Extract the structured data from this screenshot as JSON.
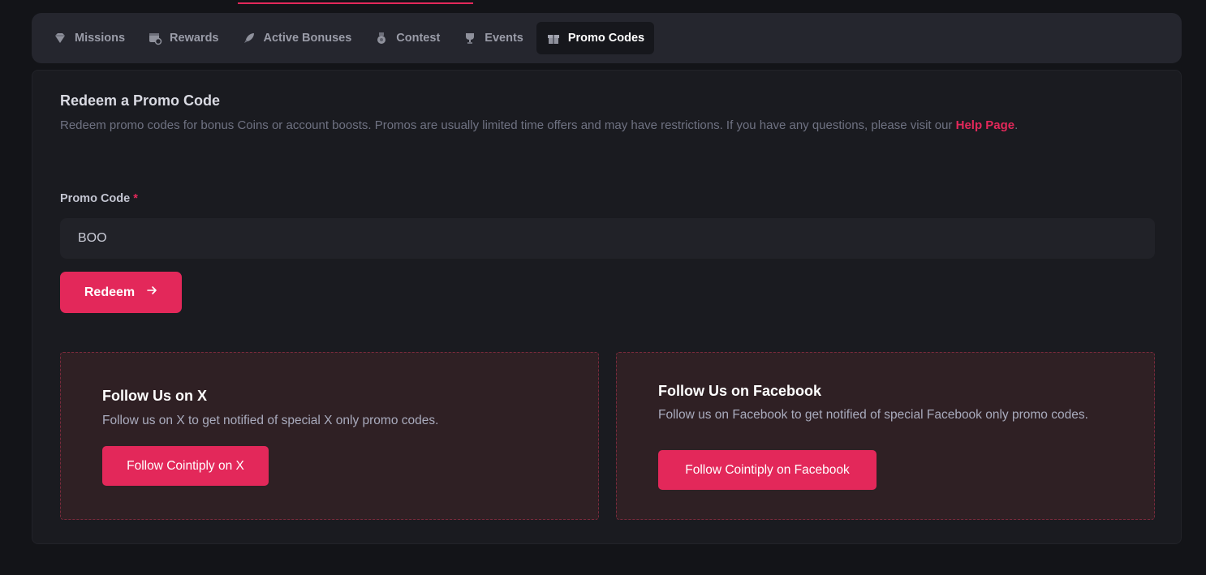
{
  "tabs": [
    {
      "label": "Missions",
      "icon": "diamond-icon"
    },
    {
      "label": "Rewards",
      "icon": "calendar-gear-icon"
    },
    {
      "label": "Active Bonuses",
      "icon": "rocket-icon"
    },
    {
      "label": "Contest",
      "icon": "medal-icon"
    },
    {
      "label": "Events",
      "icon": "trophy-icon"
    },
    {
      "label": "Promo Codes",
      "icon": "gift-box-icon",
      "active": true
    }
  ],
  "redeem": {
    "title": "Redeem a Promo Code",
    "description": "Redeem promo codes for bonus Coins or account boosts. Promos are usually limited time offers and may have restrictions. If you have any questions, please visit our ",
    "help_link": "Help Page",
    "description_end": ".",
    "field_label": "Promo Code",
    "required_marker": "*",
    "input_value": "BOO",
    "button_label": "Redeem"
  },
  "follow_x": {
    "title": "Follow Us on X",
    "description": "Follow us on X to get notified of special X only promo codes.",
    "button_label": "Follow Cointiply on X"
  },
  "follow_facebook": {
    "title": "Follow Us on Facebook",
    "description": "Follow us on Facebook to get notified of special Facebook only promo codes.",
    "button_label": "Follow Cointiply on Facebook"
  },
  "colors": {
    "accent": "#e3285a",
    "background": "#131418",
    "panel": "#1a1b20",
    "card": "#2f2024"
  }
}
